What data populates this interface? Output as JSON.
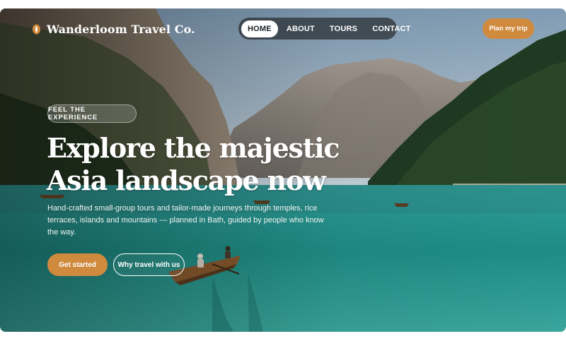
{
  "brand": {
    "name": "Wanderloom Travel Co.",
    "logo_icon": "flame-leaf-icon"
  },
  "nav": {
    "items": [
      {
        "label": "HOME",
        "active": true
      },
      {
        "label": "ABOUT",
        "active": false
      },
      {
        "label": "TOURS",
        "active": false
      },
      {
        "label": "CONTACT",
        "active": false
      }
    ]
  },
  "header_cta": "Plan my trip",
  "hero": {
    "eyebrow": "FEEL THE EXPERIENCE",
    "headline_line1": "Explore the majestic",
    "headline_line2": "Asia landscape now",
    "subtext": "Hand-crafted small-group tours and tailor-made journeys through temples, rice terraces, islands and mountains — planned in Bath, guided by people who know the way.",
    "primary_cta": "Get started",
    "secondary_cta": "Why travel with us"
  },
  "colors": {
    "accent": "#d08a3e",
    "nav_bg": "#2a2e32",
    "text_on_image": "#ffffff"
  }
}
